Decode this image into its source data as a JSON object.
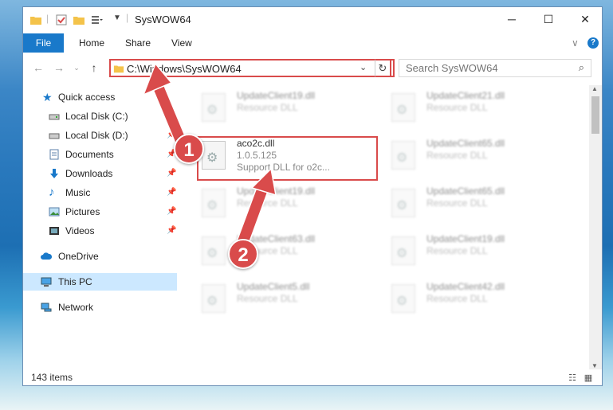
{
  "window": {
    "title": "SysWOW64",
    "minimize": "─",
    "maximize": "☐",
    "close": "✕"
  },
  "ribbon": {
    "file": "File",
    "tabs": [
      "Home",
      "Share",
      "View"
    ],
    "collapse": "∨",
    "help": "?"
  },
  "address": {
    "path": "C:\\Windows\\SysWOW64",
    "chevron": "⌄",
    "refresh": "↻",
    "search_placeholder": "Search SysWOW64"
  },
  "nav": {
    "quick_access": "Quick access",
    "pinned": [
      {
        "label": "Local Disk (C:)",
        "icon": "drive-icon"
      },
      {
        "label": "Local Disk (D:)",
        "icon": "drive-icon"
      },
      {
        "label": "Documents",
        "icon": "documents-icon"
      },
      {
        "label": "Downloads",
        "icon": "downloads-icon"
      },
      {
        "label": "Music",
        "icon": "music-icon"
      },
      {
        "label": "Pictures",
        "icon": "pictures-icon"
      },
      {
        "label": "Videos",
        "icon": "videos-icon"
      }
    ],
    "onedrive": "OneDrive",
    "this_pc": "This PC",
    "network": "Network"
  },
  "files": {
    "main": {
      "name": "aco2c.dll",
      "line1": "1.0.5.125",
      "line2": "Support DLL for o2c..."
    },
    "blurred": [
      {
        "name": "UpdateClient19.dll",
        "line1": "Resource DLL"
      },
      {
        "name": "UpdateClient21.dll",
        "line1": "Resource DLL"
      },
      {
        "name": "UpdateClient65.dll",
        "line1": "Resource DLL"
      },
      {
        "name": "UpdateClient19.dll",
        "line1": "Resource DLL"
      },
      {
        "name": "UpdateClient65.dll",
        "line1": "Resource DLL"
      },
      {
        "name": "UpdateClient63.dll",
        "line1": "Resource DLL"
      },
      {
        "name": "UpdateClient19.dll",
        "line1": "Resource DLL"
      },
      {
        "name": "UpdateClient5.dll",
        "line1": "Resource DLL"
      },
      {
        "name": "UpdateClient42.dll",
        "line1": "Resource DLL"
      }
    ]
  },
  "status": {
    "count": "143 items"
  },
  "badges": {
    "one": "1",
    "two": "2"
  },
  "colors": {
    "accent": "#1979ca",
    "annotation": "#d94b4b",
    "selection": "#cce8ff"
  }
}
